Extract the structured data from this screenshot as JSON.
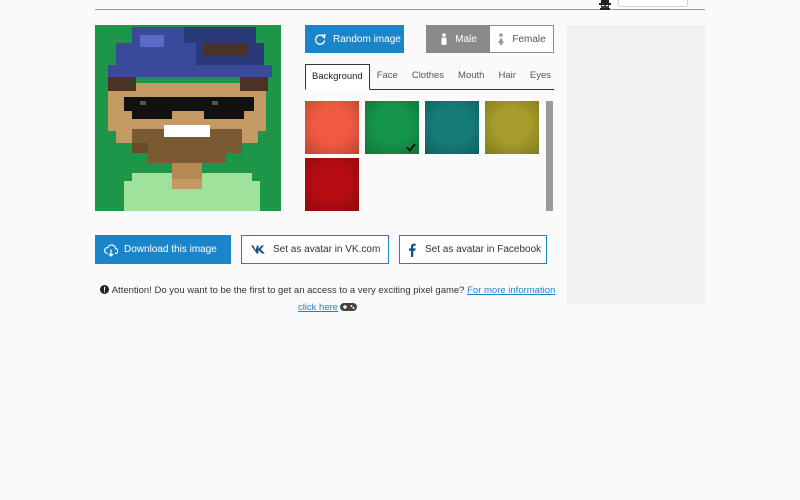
{
  "header": {
    "logo_icon": "pixel-character-icon"
  },
  "toolbar": {
    "random_label": "Random image",
    "random_icon": "refresh-icon",
    "male_label": "Male",
    "female_label": "Female"
  },
  "tabs": [
    {
      "label": "Background",
      "active": true
    },
    {
      "label": "Face",
      "active": false
    },
    {
      "label": "Clothes",
      "active": false
    },
    {
      "label": "Mouth",
      "active": false
    },
    {
      "label": "Hair",
      "active": false
    },
    {
      "label": "Eyes",
      "active": false
    }
  ],
  "swatches": [
    {
      "color": "#f05a42",
      "selected": false
    },
    {
      "color": "#15954a",
      "selected": true
    },
    {
      "color": "#157c78",
      "selected": false
    },
    {
      "color": "#a59c2a",
      "selected": false
    },
    {
      "color": "#b50c12",
      "selected": false
    }
  ],
  "actions": {
    "download_label": "Download this image",
    "vk_label": "Set as avatar in VK.com",
    "fb_label": "Set as avatar in Facebook"
  },
  "notice": {
    "text": "Attention! Do you want to be the first to get an access to a very exciting pixel game?",
    "link1": "For more information",
    "link2": "click here"
  },
  "colors": {
    "accent": "#1a86c9",
    "background": "#fafafa",
    "gender_selected": "#8a8a8a"
  }
}
